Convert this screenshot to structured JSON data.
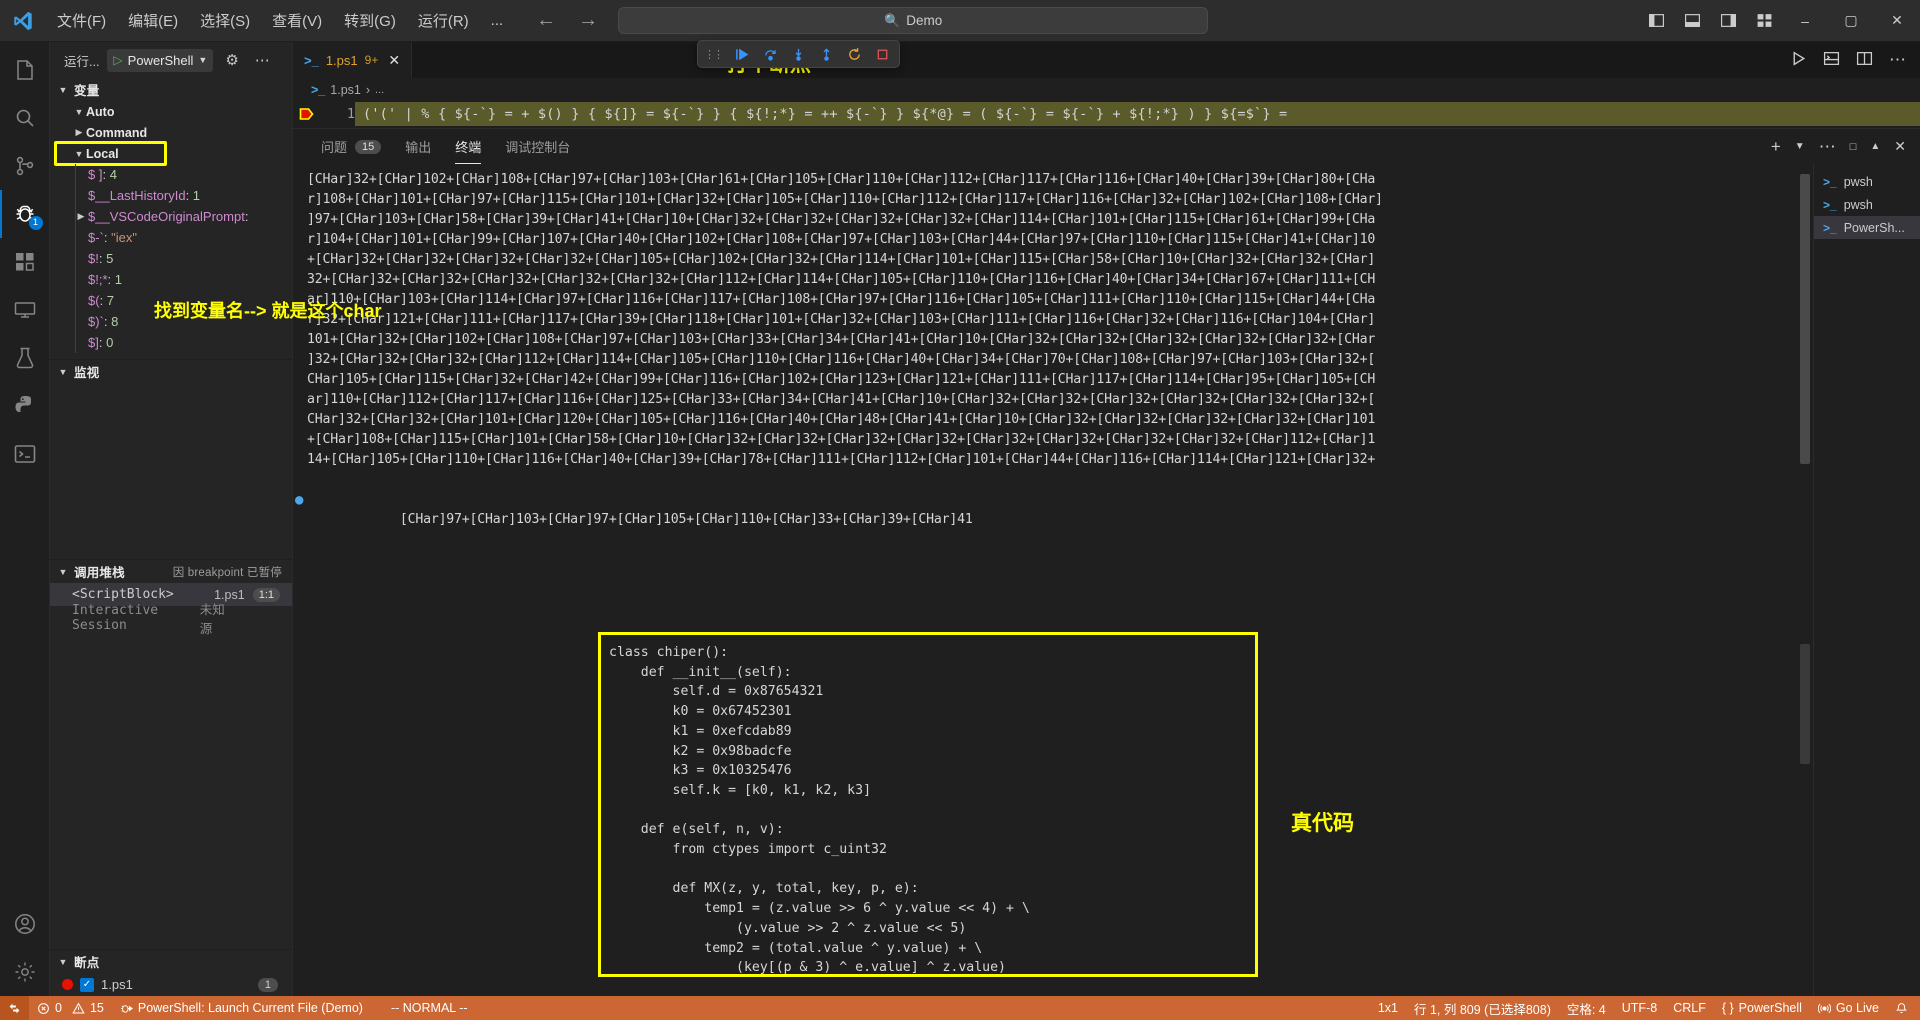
{
  "titlebar": {
    "logo_icon": "vscode-logo",
    "menus": [
      "文件(F)",
      "编辑(E)",
      "选择(S)",
      "查看(V)",
      "转到(G)",
      "运行(R)",
      "..."
    ],
    "back_icon": "arrow-left-icon",
    "forward_icon": "arrow-right-icon",
    "command_center": {
      "icon": "search-icon",
      "text": "Demo"
    },
    "layout_icons": [
      "toggle-primary-sidebar-icon",
      "toggle-panel-icon",
      "toggle-secondary-sidebar-icon",
      "customize-layout-icon"
    ],
    "window_controls": {
      "minimize": "–",
      "maximize": "▢",
      "close": "✕"
    }
  },
  "activitybar": {
    "items": [
      {
        "name": "explorer",
        "icon": "files-icon"
      },
      {
        "name": "search",
        "icon": "search-icon"
      },
      {
        "name": "source-control",
        "icon": "source-control-icon"
      },
      {
        "name": "run-and-debug",
        "icon": "debug-icon",
        "badge": "1",
        "active": true
      },
      {
        "name": "extensions",
        "icon": "extensions-icon"
      },
      {
        "name": "remote-explorer",
        "icon": "remote-icon"
      },
      {
        "name": "testing",
        "icon": "beaker-icon"
      },
      {
        "name": "python",
        "icon": "python-icon"
      },
      {
        "name": "terminal-view",
        "icon": "terminal-icon"
      }
    ],
    "bottom": [
      {
        "name": "accounts",
        "icon": "account-icon"
      },
      {
        "name": "settings",
        "icon": "gear-icon"
      }
    ]
  },
  "sidebar": {
    "header": {
      "run_label": "运行...",
      "config_name": "PowerShell",
      "play_icon": "play-icon",
      "chevron_icon": "chevron-down-icon",
      "gear_icon": "gear-icon",
      "more_icon": "more-actions-icon"
    },
    "variables": {
      "title": "变量",
      "scopes": [
        {
          "label": "Auto",
          "expanded": true
        },
        {
          "label": "Command",
          "expanded": false
        },
        {
          "label": "Local",
          "expanded": true,
          "highlighted": true
        }
      ],
      "locals": [
        {
          "name": "$ ]",
          "value": "4",
          "kind": "number",
          "expandable": false
        },
        {
          "name": "$__LastHistoryId",
          "value": "1",
          "kind": "number",
          "expandable": false
        },
        {
          "name": "$__VSCodeOriginalPrompt",
          "value": "",
          "kind": "object",
          "expandable": true
        },
        {
          "name": "$-`",
          "value": "\"iex\"",
          "kind": "string",
          "expandable": false
        },
        {
          "name": "$!",
          "value": "5",
          "kind": "number",
          "expandable": false
        },
        {
          "name": "$!;*",
          "value": "1",
          "kind": "number",
          "expandable": false
        },
        {
          "name": "$(",
          "value": "7",
          "kind": "number",
          "expandable": false
        },
        {
          "name": "$)`",
          "value": "8",
          "kind": "number",
          "expandable": false
        },
        {
          "name": "$]",
          "value": "0",
          "kind": "number",
          "expandable": false
        }
      ]
    },
    "watch": {
      "title": "监视"
    },
    "callstack": {
      "title": "调用堆栈",
      "status": "因 breakpoint 已暂停",
      "bug_icon": "bug-icon",
      "frames": [
        {
          "name": "<ScriptBlock>",
          "file": "1.ps1",
          "pos": "1:1",
          "selected": true
        },
        {
          "name": "Interactive Session",
          "file": "未知源",
          "selected": false
        }
      ]
    },
    "breakpoints": {
      "title": "断点",
      "items": [
        {
          "file": "1.ps1",
          "checked": true,
          "count": "1"
        }
      ]
    }
  },
  "editor": {
    "tabs": [
      {
        "label": "1.ps1",
        "icon": "powershell-icon",
        "dirty_badge": "9+",
        "close_icon": "close-icon",
        "active": true
      }
    ],
    "tab_actions": [
      "run-icon",
      "split-terminal-icon",
      "split-editor-icon",
      "more-actions-icon"
    ],
    "breadcrumb": {
      "icon": "powershell-icon",
      "file": "1.ps1",
      "separator": "›",
      "rest": "..."
    },
    "line_number": "1",
    "breakpoint_glyph": "breakpoint-arrow-icon",
    "code_line": "('('  | % { ${-`} = + $() } { ${]} = ${-`} } { ${!;*} = ++ ${-`} } ${*@} = ( ${-`} = ${-`} + ${!;*} ) } ${=$`} ="
  },
  "debug_toolbar": {
    "grip_icon": "drag-handle-icon",
    "buttons": [
      {
        "name": "continue",
        "icon": "continue-icon"
      },
      {
        "name": "step-over",
        "icon": "step-over-icon"
      },
      {
        "name": "step-into",
        "icon": "step-into-icon"
      },
      {
        "name": "step-out",
        "icon": "step-out-icon"
      },
      {
        "name": "restart",
        "icon": "restart-icon"
      },
      {
        "name": "stop",
        "icon": "stop-icon"
      }
    ]
  },
  "panel": {
    "tabs": [
      {
        "label": "问题",
        "count": "15",
        "active": false
      },
      {
        "label": "输出",
        "count": "",
        "active": false
      },
      {
        "label": "终端",
        "count": "",
        "active": true
      },
      {
        "label": "调试控制台",
        "count": "",
        "active": false
      }
    ],
    "actions": [
      "add-terminal-icon",
      "chevron-down-icon",
      "more-actions-icon",
      "maximize-panel-icon",
      "chevron-up-icon",
      "close-icon"
    ],
    "terminal_output": "[CHar]32+[CHar]102+[CHar]108+[CHar]97+[CHar]103+[CHar]61+[CHar]105+[CHar]110+[CHar]112+[CHar]117+[CHar]116+[CHar]40+[CHar]39+[CHar]80+[CHa\nr]108+[CHar]101+[CHar]97+[CHar]115+[CHar]101+[CHar]32+[CHar]105+[CHar]110+[CHar]112+[CHar]117+[CHar]116+[CHar]32+[CHar]102+[CHar]108+[CHar]\n]97+[CHar]103+[CHar]58+[CHar]39+[CHar]41+[CHar]10+[CHar]32+[CHar]32+[CHar]32+[CHar]32+[CHar]114+[CHar]101+[CHar]115+[CHar]61+[CHar]99+[CHa\nr]104+[CHar]101+[CHar]99+[CHar]107+[CHar]40+[CHar]102+[CHar]108+[CHar]97+[CHar]103+[CHar]44+[CHar]97+[CHar]110+[CHar]115+[CHar]41+[CHar]10\n+[CHar]32+[CHar]32+[CHar]32+[CHar]32+[CHar]105+[CHar]102+[CHar]32+[CHar]114+[CHar]101+[CHar]115+[CHar]58+[CHar]10+[CHar]32+[CHar]32+[CHar]\n32+[CHar]32+[CHar]32+[CHar]32+[CHar]32+[CHar]32+[CHar]112+[CHar]114+[CHar]105+[CHar]110+[CHar]116+[CHar]40+[CHar]34+[CHar]67+[CHar]111+[CH\nar]110+[CHar]103+[CHar]114+[CHar]97+[CHar]116+[CHar]117+[CHar]108+[CHar]97+[CHar]116+[CHar]105+[CHar]111+[CHar]110+[CHar]115+[CHar]44+[CHa\nr]32+[CHar]121+[CHar]111+[CHar]117+[CHar]39+[CHar]118+[CHar]101+[CHar]32+[CHar]103+[CHar]111+[CHar]116+[CHar]32+[CHar]116+[CHar]104+[CHar]\n101+[CHar]32+[CHar]102+[CHar]108+[CHar]97+[CHar]103+[CHar]33+[CHar]34+[CHar]41+[CHar]10+[CHar]32+[CHar]32+[CHar]32+[CHar]32+[CHar]32+[CHar\n]32+[CHar]32+[CHar]32+[CHar]112+[CHar]114+[CHar]105+[CHar]110+[CHar]116+[CHar]40+[CHar]34+[CHar]70+[CHar]108+[CHar]97+[CHar]103+[CHar]32+[\nCHar]105+[CHar]115+[CHar]32+[CHar]42+[CHar]99+[CHar]116+[CHar]102+[CHar]123+[CHar]121+[CHar]111+[CHar]117+[CHar]114+[CHar]95+[CHar]105+[CH\nar]110+[CHar]112+[CHar]117+[CHar]116+[CHar]125+[CHar]33+[CHar]34+[CHar]41+[CHar]10+[CHar]32+[CHar]32+[CHar]32+[CHar]32+[CHar]32+[CHar]32+[\nCHar]32+[CHar]32+[CHar]101+[CHar]120+[CHar]105+[CHar]116+[CHar]40+[CHar]48+[CHar]41+[CHar]10+[CHar]32+[CHar]32+[CHar]32+[CHar]32+[CHar]101\n+[CHar]108+[CHar]115+[CHar]101+[CHar]58+[CHar]10+[CHar]32+[CHar]32+[CHar]32+[CHar]32+[CHar]32+[CHar]32+[CHar]32+[CHar]32+[CHar]112+[CHar]1\n14+[CHar]105+[CHar]110+[CHar]116+[CHar]40+[CHar]39+[CHar]78+[CHar]111+[CHar]112+[CHar]101+[CHar]44+[CHar]116+[CHar]114+[CHar]121+[CHar]32+",
    "terminal_last_line": "[CHar]97+[CHar]103+[CHar]97+[CHar]105+[CHar]110+[CHar]33+[CHar]39+[CHar]41",
    "code_block": "class chiper():\n    def __init__(self):\n        self.d = 0x87654321\n        k0 = 0x67452301\n        k1 = 0xefcdab89\n        k2 = 0x98badcfe\n        k3 = 0x10325476\n        self.k = [k0, k1, k2, k3]\n\n    def e(self, n, v):\n        from ctypes import c_uint32\n\n        def MX(z, y, total, key, p, e):\n            temp1 = (z.value >> 6 ^ y.value << 4) + \\\n                (y.value >> 2 ^ z.value << 5)\n            temp2 = (total.value ^ y.value) + \\\n                (key[(p & 3) ^ e.value] ^ z.value)",
    "terminal_list": [
      {
        "label": "pwsh",
        "icon": "powershell-icon",
        "selected": false
      },
      {
        "label": "pwsh",
        "icon": "powershell-icon",
        "selected": false
      },
      {
        "label": "PowerSh...",
        "icon": "powershell-icon",
        "selected": true
      }
    ]
  },
  "annotations": {
    "breakpoint_note": "打个断点",
    "variable_note": "找到变量名--> 就是这个char",
    "realcode_note": "真代码",
    "color": "#ffff00"
  },
  "statusbar": {
    "remote_icon": "remote-indicator-icon",
    "error_icon": "error-icon",
    "error_count": "0",
    "warning_icon": "warning-icon",
    "warning_count": "15",
    "launch_icon": "debug-start-icon",
    "launch_text": "PowerShell: Launch Current File (Demo)",
    "mode_text": "-- NORMAL --",
    "right_items": [
      {
        "name": "grid-size",
        "text": "1x1"
      },
      {
        "name": "cursor-position",
        "text": "行 1, 列 809 (已选择808)"
      },
      {
        "name": "indentation",
        "text": "空格: 4"
      },
      {
        "name": "encoding",
        "text": "UTF-8"
      },
      {
        "name": "eol",
        "text": "CRLF"
      },
      {
        "name": "language-mode",
        "text": "PowerShell",
        "icon": "braces-icon"
      },
      {
        "name": "go-live",
        "text": "Go Live",
        "icon": "broadcast-icon"
      },
      {
        "name": "notifications",
        "text": "",
        "icon": "bell-icon"
      }
    ]
  }
}
